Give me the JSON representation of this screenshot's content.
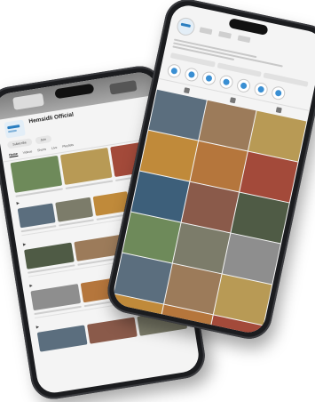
{
  "youtube": {
    "channel_name": "Hemsidli Official",
    "tabs": [
      "Home",
      "Videos",
      "Shorts",
      "Live",
      "Playlists"
    ],
    "subscribe_label": "Subscribe",
    "join_label": "Join"
  },
  "colors": {
    "phone_frame": "#1b1c1f",
    "brand_blue": "#2a7ec0",
    "thumb_palette": [
      "#6e8a5a",
      "#b89a55",
      "#8a5a4a",
      "#5b6e7e",
      "#a34a3a",
      "#7c7c6a",
      "#c08a3a",
      "#4f5b45",
      "#9c7b5a",
      "#3d5f7a",
      "#8e8e8e",
      "#b5763c"
    ]
  },
  "instagram": {
    "highlight_icons": [
      "highlight-1-icon",
      "highlight-2-icon",
      "highlight-3-icon",
      "highlight-4-icon",
      "highlight-5-icon",
      "highlight-6-icon",
      "highlight-7-icon"
    ],
    "grid_captions": [
      "",
      "",
      "",
      "",
      "",
      "",
      "",
      "",
      "",
      "",
      "",
      "",
      "",
      "",
      "",
      "",
      "",
      ""
    ]
  }
}
